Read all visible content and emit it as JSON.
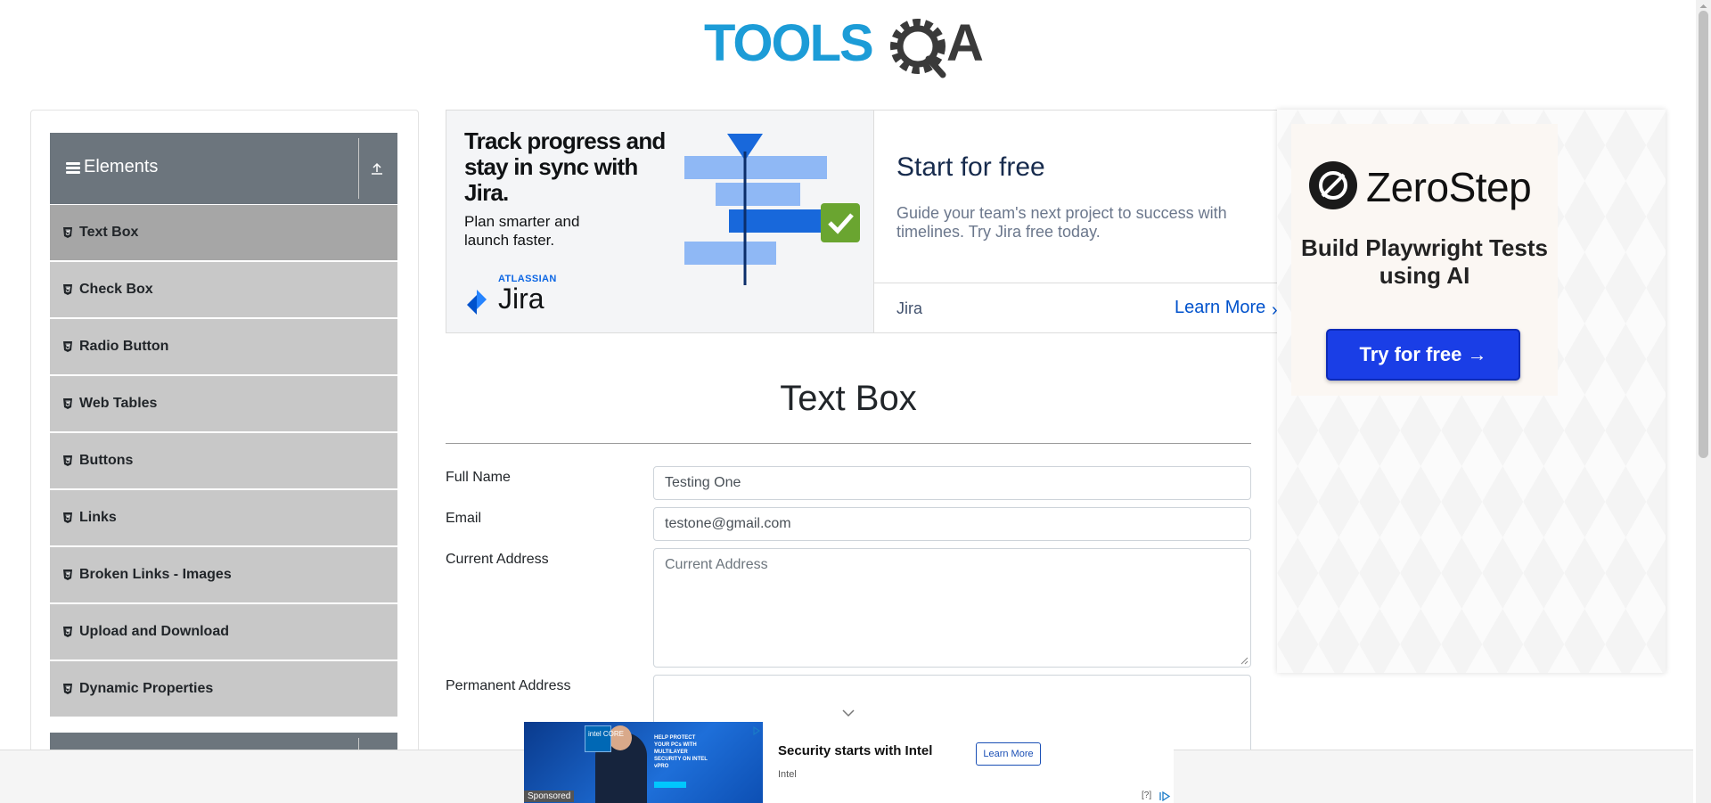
{
  "header": {
    "logo_text_left": "TOOLS",
    "logo_text_right": "A"
  },
  "sidebar": {
    "group_title": "Elements",
    "items": [
      {
        "label": "Text Box",
        "active": true
      },
      {
        "label": "Check Box"
      },
      {
        "label": "Radio Button"
      },
      {
        "label": "Web Tables"
      },
      {
        "label": "Buttons"
      },
      {
        "label": "Links"
      },
      {
        "label": "Broken Links - Images"
      },
      {
        "label": "Upload and Download"
      },
      {
        "label": "Dynamic Properties"
      }
    ]
  },
  "jira_ad": {
    "headline": "Track progress and stay in sync with Jira.",
    "sub": "Plan smarter and launch faster.",
    "atlassian": "ATLASSIAN",
    "jira_word": "Jira",
    "start_title": "Start for free",
    "description": "Guide your team's next project to success with timelines. Try Jira free today.",
    "brand": "Jira",
    "learn_more": "Learn More"
  },
  "zerostep_ad": {
    "brand": "ZeroStep",
    "tagline": "Build Playwright Tests using AI",
    "cta": "Try for free →"
  },
  "main": {
    "title": "Text Box",
    "full_name_label": "Full Name",
    "full_name_value": "Testing One",
    "email_label": "Email",
    "email_value": "testone@gmail.com",
    "current_address_label": "Current Address",
    "current_address_placeholder": "Current Address",
    "permanent_address_label": "Permanent Address"
  },
  "bottom_ad": {
    "title": "Security starts with Intel",
    "brand": "Intel",
    "learn_more": "Learn More",
    "sponsored": "Sponsored",
    "help": "[?]",
    "image_chip": "intel CORE",
    "image_copy": "HELP PROTECT YOUR PCs WITH MULTILAYER SECURITY ON INTEL vPRO"
  },
  "colors": {
    "sidebar_header": "#6c757d",
    "menu_item": "#c8c8c8",
    "menu_item_active": "#a6a6a6",
    "logo_blue": "#1c9cd7",
    "logo_dark": "#3a3a3a",
    "zerostep_button": "#1a3ee6",
    "jira_link": "#0052cc"
  }
}
